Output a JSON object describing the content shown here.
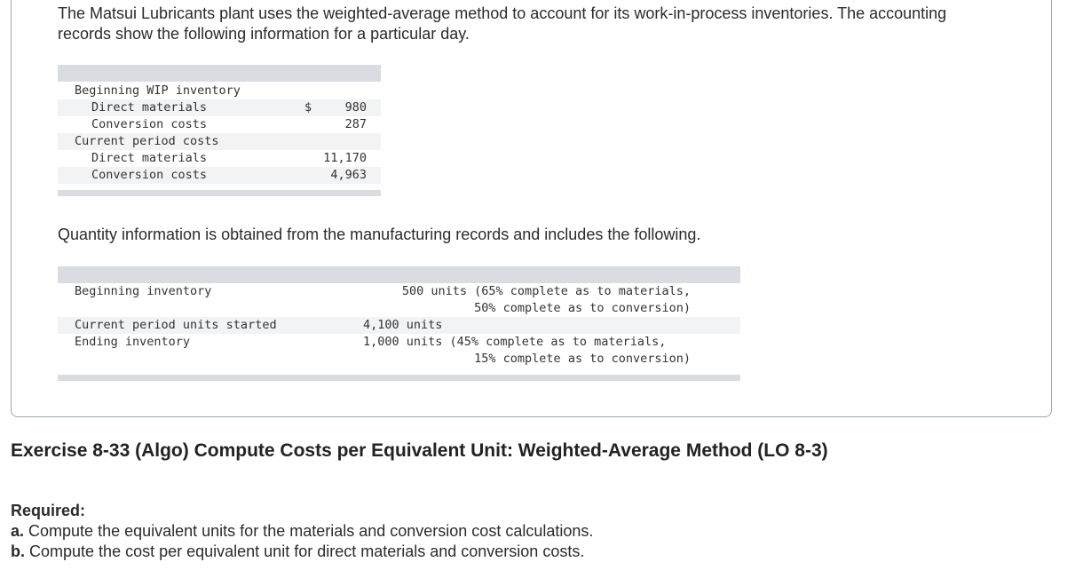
{
  "intro": "The Matsui Lubricants plant uses the weighted-average method to account for its work-in-process inventories. The accounting records show the following information for a particular day.",
  "cost_table": {
    "beginning_header": "Beginning WIP inventory",
    "bwip_dm_label": "Direct materials",
    "bwip_dm_currency": "$",
    "bwip_dm_value": "980",
    "bwip_cc_label": "Conversion costs",
    "bwip_cc_value": "287",
    "current_header": "Current period costs",
    "cur_dm_label": "Direct materials",
    "cur_dm_value": "11,170",
    "cur_cc_label": "Conversion costs",
    "cur_cc_value": "4,963"
  },
  "quantity_intro": "Quantity information is obtained from the manufacturing records and includes the following.",
  "quantity_table": {
    "beg_label": "Beginning inventory",
    "beg_value_line1": "500 units (65% complete as to materials,",
    "beg_value_line2": "50% complete as to conversion)",
    "started_label": "Current period units started",
    "started_value": "4,100 units",
    "end_label": "Ending inventory",
    "end_value_line1": "1,000 units (45% complete as to materials,",
    "end_value_line2": "15% complete as to conversion)"
  },
  "exercise_title": "Exercise 8-33 (Algo) Compute Costs per Equivalent Unit: Weighted-Average Method (LO 8-3)",
  "required": {
    "heading": "Required:",
    "a_marker": "a.",
    "a_text": "Compute the equivalent units for the materials and conversion cost calculations.",
    "b_marker": "b.",
    "b_text": "Compute the cost per equivalent unit for direct materials and conversion costs."
  }
}
